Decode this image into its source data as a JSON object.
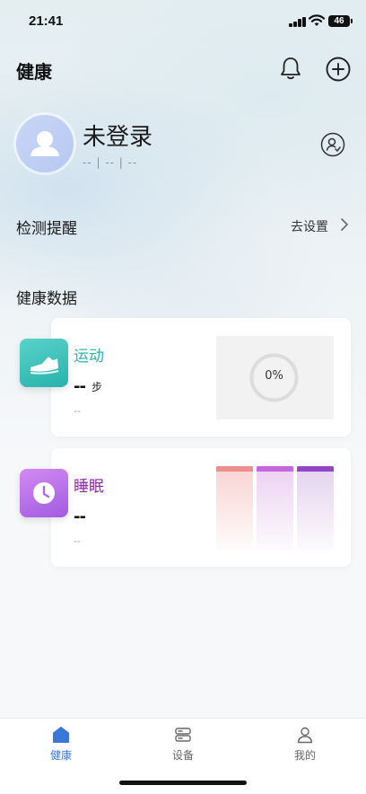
{
  "status_bar": {
    "time": "21:41",
    "battery": "46"
  },
  "header": {
    "title": "健康"
  },
  "user": {
    "name": "未登录",
    "subtitle": "-- | -- | --"
  },
  "reminder": {
    "title": "检测提醒",
    "action": "去设置"
  },
  "section": {
    "title": "健康数据"
  },
  "exercise": {
    "label": "运动",
    "value": "--",
    "unit": "步",
    "sub": "--",
    "progress_percent": 0,
    "progress_text": "0%",
    "color": "#2eb5ad"
  },
  "sleep": {
    "label": "睡眠",
    "value": "--",
    "sub": "--",
    "color": "#8a2a9c"
  },
  "tab_bar": {
    "active": "health",
    "tabs": [
      {
        "id": "health",
        "label": "健康"
      },
      {
        "id": "device",
        "label": "设备"
      },
      {
        "id": "mine",
        "label": "我的"
      }
    ]
  },
  "colors": {
    "accent": "#3b77d9"
  }
}
